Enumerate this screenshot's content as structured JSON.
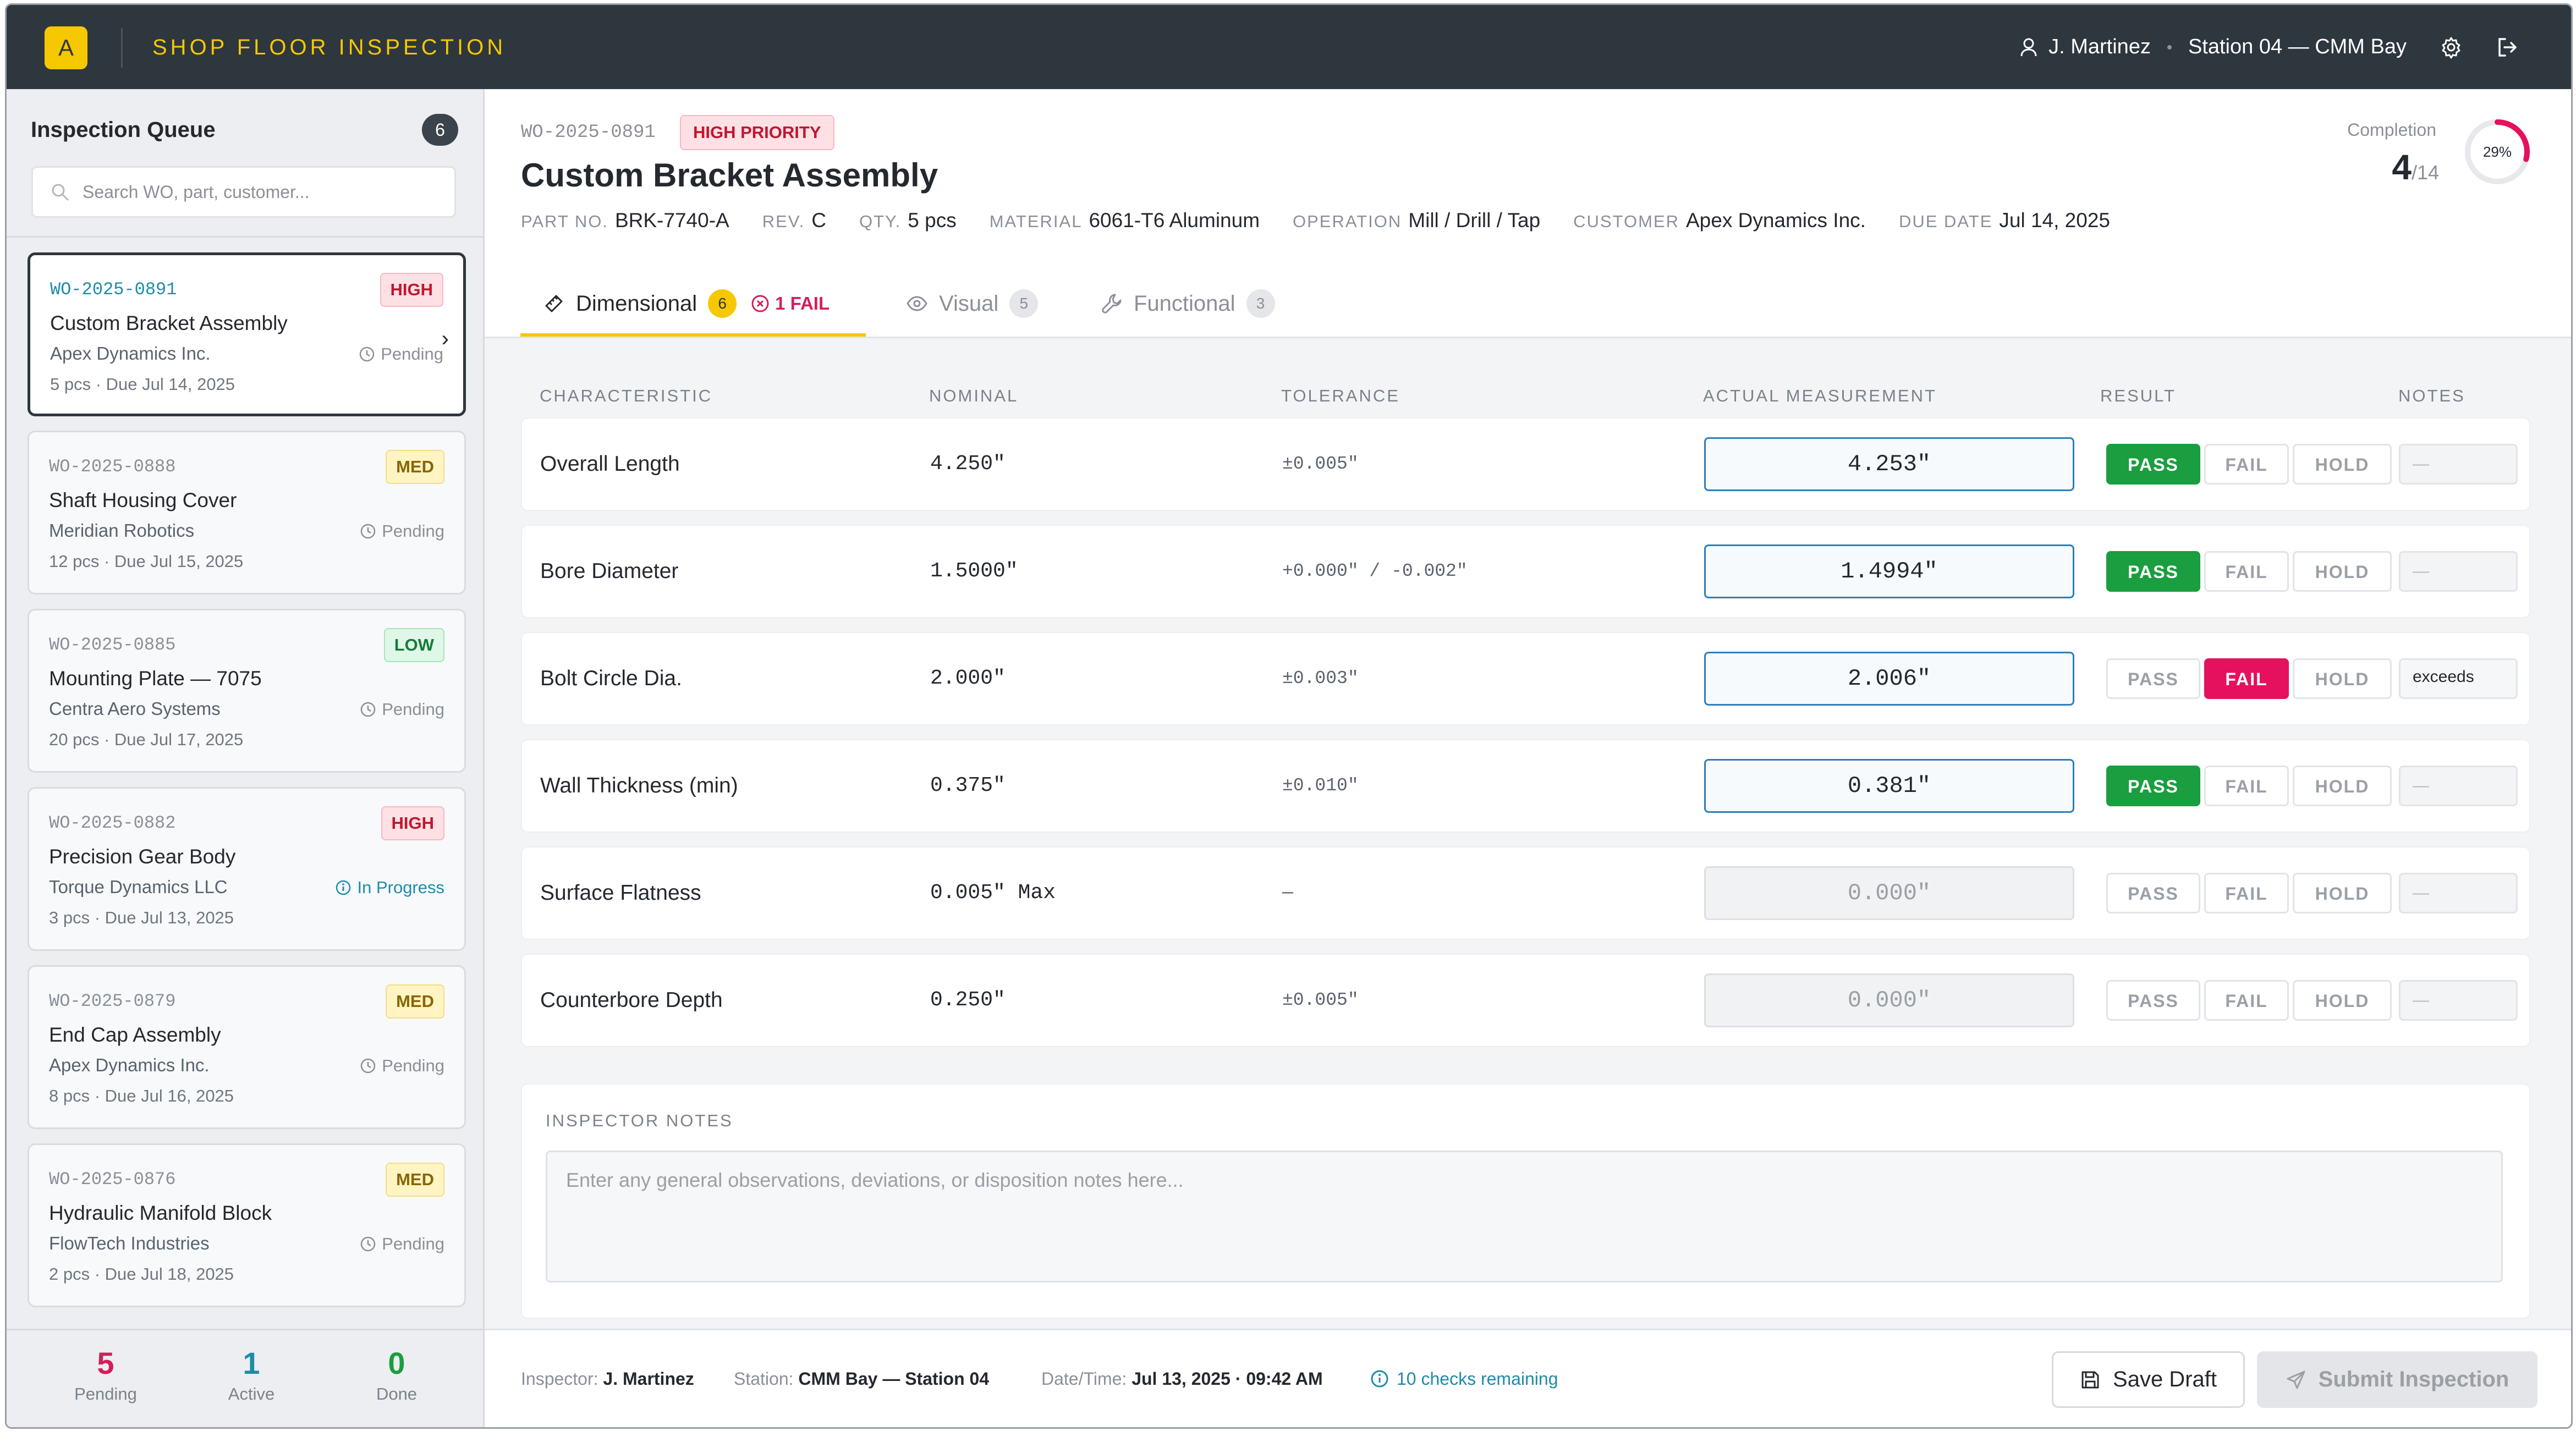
{
  "app": {
    "logo_letter": "A",
    "title": "SHOP FLOOR INSPECTION",
    "user": "J. Martinez",
    "station": "Station 04 — CMM Bay"
  },
  "sidebar": {
    "title": "Inspection Queue",
    "count": "6",
    "search_placeholder": "Search WO, part, customer...",
    "items": [
      {
        "wo": "WO-2025-0891",
        "title": "Custom Bracket Assembly",
        "customer": "Apex Dynamics Inc.",
        "meta": "5 pcs · Due Jul 14, 2025",
        "priority": "HIGH",
        "status": "Pending"
      },
      {
        "wo": "WO-2025-0888",
        "title": "Shaft Housing Cover",
        "customer": "Meridian Robotics",
        "meta": "12 pcs · Due Jul 15, 2025",
        "priority": "MED",
        "status": "Pending"
      },
      {
        "wo": "WO-2025-0885",
        "title": "Mounting Plate — 7075",
        "customer": "Centra Aero Systems",
        "meta": "20 pcs · Due Jul 17, 2025",
        "priority": "LOW",
        "status": "Pending"
      },
      {
        "wo": "WO-2025-0882",
        "title": "Precision Gear Body",
        "customer": "Torque Dynamics LLC",
        "meta": "3 pcs · Due Jul 13, 2025",
        "priority": "HIGH",
        "status": "In Progress"
      },
      {
        "wo": "WO-2025-0879",
        "title": "End Cap Assembly",
        "customer": "Apex Dynamics Inc.",
        "meta": "8 pcs · Due Jul 16, 2025",
        "priority": "MED",
        "status": "Pending"
      },
      {
        "wo": "WO-2025-0876",
        "title": "Hydraulic Manifold Block",
        "customer": "FlowTech Industries",
        "meta": "2 pcs · Due Jul 18, 2025",
        "priority": "MED",
        "status": "Pending"
      }
    ],
    "stats": [
      {
        "value": "5",
        "label": "Pending",
        "color": "#d41e5c"
      },
      {
        "value": "1",
        "label": "Active",
        "color": "#1d8ca8"
      },
      {
        "value": "0",
        "label": "Done",
        "color": "#1a9e3f"
      }
    ]
  },
  "header": {
    "wo": "WO-2025-0891",
    "priority": "HIGH PRIORITY",
    "title": "Custom Bracket Assembly",
    "meta": [
      {
        "key": "PART NO.",
        "value": "BRK-7740-A"
      },
      {
        "key": "REV.",
        "value": "C"
      },
      {
        "key": "QTY.",
        "value": "5 pcs"
      },
      {
        "key": "MATERIAL",
        "value": "6061-T6 Aluminum"
      },
      {
        "key": "OPERATION",
        "value": "Mill / Drill / Tap"
      },
      {
        "key": "CUSTOMER",
        "value": "Apex Dynamics Inc."
      },
      {
        "key": "DUE DATE",
        "value": "Jul 14, 2025"
      }
    ],
    "completion": {
      "label": "Completion",
      "done": "4",
      "total": "/14",
      "percent_label": "29%",
      "fraction": 0.29
    }
  },
  "tabs": [
    {
      "label": "Dimensional",
      "count": "6",
      "fail": "1 FAIL",
      "active": true
    },
    {
      "label": "Visual",
      "count": "5"
    },
    {
      "label": "Functional",
      "count": "3"
    }
  ],
  "table": {
    "headers": [
      "CHARACTERISTIC",
      "NOMINAL",
      "TOLERANCE",
      "ACTUAL MEASUREMENT",
      "RESULT",
      "NOTES"
    ],
    "result_labels": {
      "pass": "PASS",
      "fail": "FAIL",
      "hold": "HOLD"
    },
    "rows": [
      {
        "characteristic": "Overall Length",
        "nominal": "4.250\"",
        "tolerance": "±0.005\"",
        "actual": "4.253\"",
        "result": "pass",
        "note": "—"
      },
      {
        "characteristic": "Bore Diameter",
        "nominal": "1.5000\"",
        "tolerance": "+0.000\" / -0.002\"",
        "actual": "1.4994\"",
        "result": "pass",
        "note": "—"
      },
      {
        "characteristic": "Bolt Circle Dia.",
        "nominal": "2.000\"",
        "tolerance": "±0.003\"",
        "actual": "2.006\"",
        "result": "fail",
        "note": "exceeds"
      },
      {
        "characteristic": "Wall Thickness (min)",
        "nominal": "0.375\"",
        "tolerance": "±0.010\"",
        "actual": "0.381\"",
        "result": "pass",
        "note": "—"
      },
      {
        "characteristic": "Surface Flatness",
        "nominal": "0.005\" Max",
        "tolerance": "—",
        "placeholder": "0.000\"",
        "result": "",
        "note": "—"
      },
      {
        "characteristic": "Counterbore Depth",
        "nominal": "0.250\"",
        "tolerance": "±0.005\"",
        "placeholder": "0.000\"",
        "result": "",
        "note": "—"
      }
    ]
  },
  "notes": {
    "label": "INSPECTOR NOTES",
    "placeholder": "Enter any general observations, deviations, or disposition notes here..."
  },
  "footer": {
    "inspector_key": "Inspector:",
    "inspector": "J. Martinez",
    "station_key": "Station:",
    "station": "CMM Bay — Station 04",
    "datetime_key": "Date/Time:",
    "datetime": "Jul 13, 2025 · 09:42 AM",
    "remaining": "10 checks remaining",
    "save_label": "Save Draft",
    "submit_label": "Submit Inspection"
  },
  "colors": {
    "accent": "#f5c800",
    "topbar": "#2e363e",
    "pass": "#1a9e3f",
    "fail": "#e5115f",
    "info": "#1d8ca8"
  }
}
